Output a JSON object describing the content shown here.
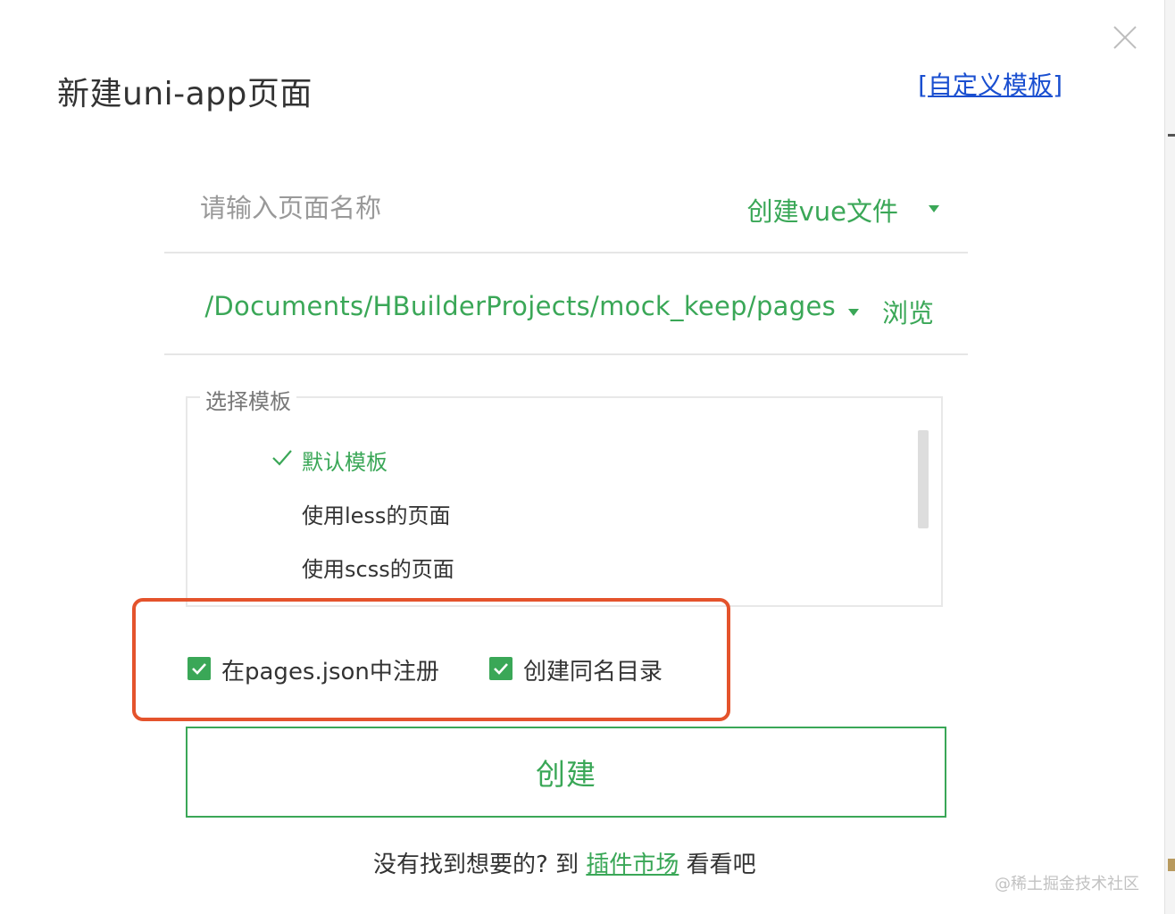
{
  "dialog": {
    "title": "新建uni-app页面",
    "custom_template": {
      "bracket_open": "[",
      "label": "自定义模板",
      "bracket_close": "]"
    },
    "close_icon": "close-icon"
  },
  "page_name": {
    "placeholder": "请输入页面名称",
    "value": "",
    "file_type": "创建vue文件"
  },
  "location": {
    "path": "/Documents/HBuilderProjects/mock_keep/pages",
    "browse_label": "浏览"
  },
  "templates": {
    "legend": "选择模板",
    "items": [
      {
        "label": "默认模板",
        "selected": true
      },
      {
        "label": "使用less的页面",
        "selected": false
      },
      {
        "label": "使用scss的页面",
        "selected": false
      }
    ]
  },
  "options": [
    {
      "label": "在pages.json中注册",
      "checked": true
    },
    {
      "label": "创建同名目录",
      "checked": true
    }
  ],
  "create_button": "创建",
  "footer": {
    "prefix": "没有找到想要的? 到",
    "market_link": "插件市场",
    "suffix": "看看吧"
  },
  "watermark": "@稀土掘金技术社区",
  "colors": {
    "accent": "#3aa757",
    "link": "#1a4fd0",
    "highlight_border": "#e4532c"
  }
}
